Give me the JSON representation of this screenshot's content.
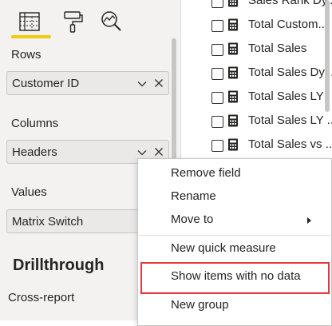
{
  "visualizations": {
    "tabs": [
      {
        "name": "build-visual",
        "icon": "table-grid-icon",
        "active": true
      },
      {
        "name": "format-visual",
        "icon": "paint-roller-icon",
        "active": false
      },
      {
        "name": "analytics",
        "icon": "analytics-magnifier-icon",
        "active": false
      }
    ],
    "accent_color": "#f2c811"
  },
  "wells": {
    "rows": {
      "label": "Rows",
      "field": "Customer ID"
    },
    "columns": {
      "label": "Columns",
      "field": "Headers"
    },
    "values": {
      "label": "Values",
      "field": "Matrix Switch"
    }
  },
  "drillthrough": {
    "heading": "Drillthrough",
    "cross_report_label": "Cross-report"
  },
  "fields_list": {
    "items": [
      {
        "label": "Sales Rank Dy...",
        "checked": false,
        "icon": "calculator-icon"
      },
      {
        "label": "Total Custom...",
        "checked": false,
        "icon": "calculator-icon"
      },
      {
        "label": "Total Sales",
        "checked": false,
        "icon": "calculator-icon"
      },
      {
        "label": "Total Sales Dy...",
        "checked": false,
        "icon": "calculator-icon"
      },
      {
        "label": "Total Sales LY",
        "checked": false,
        "icon": "calculator-icon"
      },
      {
        "label": "Total Sales LY ...",
        "checked": false,
        "icon": "calculator-icon"
      },
      {
        "label": "Total Sales vs ...",
        "checked": false,
        "icon": "calculator-icon"
      }
    ]
  },
  "context_menu": {
    "items": [
      {
        "label": "Remove field"
      },
      {
        "label": "Rename"
      },
      {
        "label": "Move to",
        "has_submenu": true
      },
      {
        "label": "New quick measure"
      },
      {
        "label": "Show items with no data",
        "highlighted": true
      },
      {
        "label": "New group"
      }
    ],
    "highlight_color": "#e03a3e"
  }
}
